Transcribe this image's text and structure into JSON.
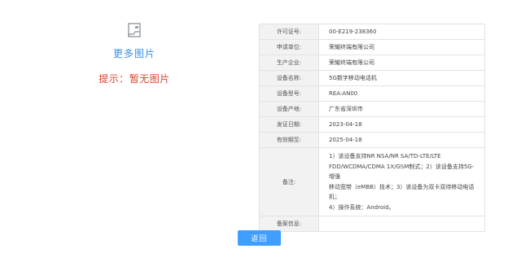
{
  "gallery": {
    "image_icon": "image-placeholder-icon",
    "more_images": "更多图片",
    "tip": "提示：暂无图片"
  },
  "table": {
    "rows": [
      {
        "label": "许可证号:",
        "value": "00-E219-238360"
      },
      {
        "label": "申请单位:",
        "value": "荣耀终端有限公司"
      },
      {
        "label": "生产企业:",
        "value": "荣耀终端有限公司"
      },
      {
        "label": "设备名称:",
        "value": "5G数字移动电话机"
      },
      {
        "label": "设备型号:",
        "value": "REA-AN00"
      },
      {
        "label": "设备产地:",
        "value": "广东省深圳市"
      },
      {
        "label": "发证日期:",
        "value": "2023-04-18"
      },
      {
        "label": "有效期至:",
        "value": "2025-04-18"
      }
    ],
    "note": {
      "label": "备注:",
      "lines": [
        "1）该设备支持NR NSA/NR SA/TD-LTE/LTE",
        "FDD/WCDMA/CDMA 1X/GSM制式；2）该设备支持5G-增强",
        "移动宽带（eMBB）技术；3）该设备为双卡双待移动电话机；",
        "4）操作系统：Android。"
      ]
    },
    "record": {
      "label": "备案信息:",
      "value": ""
    }
  },
  "actions": {
    "back_label": "返回"
  },
  "colors": {
    "accent": "#409eff",
    "link": "#3a8ee6",
    "warning": "#e0402e",
    "header_bg": "#f2f2f2",
    "border": "#e3e3e3"
  }
}
